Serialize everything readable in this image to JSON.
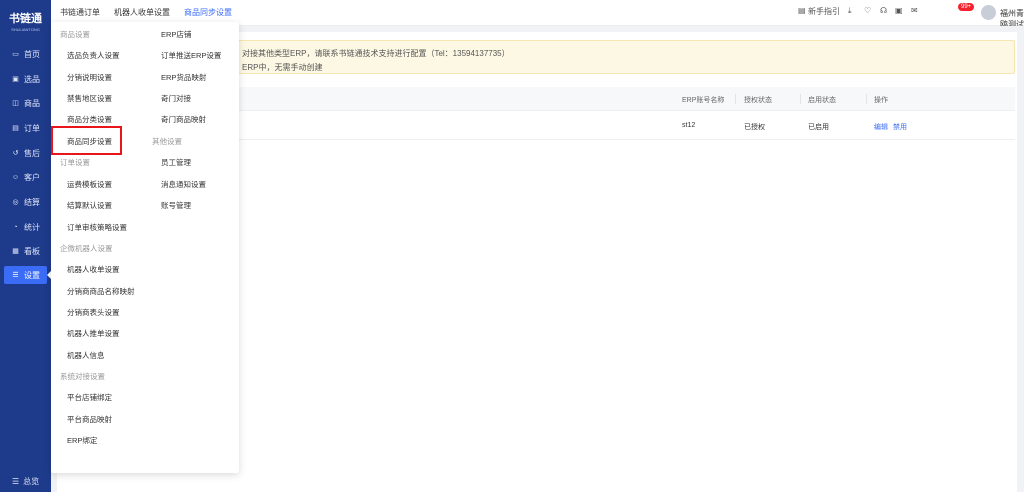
{
  "sidebar": {
    "logo_title": "书链通",
    "logo_sub": "SHULIANTONG",
    "items": [
      {
        "label": "首页",
        "icon": "monitor-icon"
      },
      {
        "label": "选品",
        "icon": "select-icon"
      },
      {
        "label": "商品",
        "icon": "goods-icon"
      },
      {
        "label": "订单",
        "icon": "order-icon"
      },
      {
        "label": "售后",
        "icon": "after-sale-icon"
      },
      {
        "label": "客户",
        "icon": "customer-icon"
      },
      {
        "label": "结算",
        "icon": "settlement-icon"
      },
      {
        "label": "统计",
        "icon": "stats-icon"
      },
      {
        "label": "看板",
        "icon": "board-icon"
      },
      {
        "label": "设置",
        "icon": "settings-icon"
      }
    ],
    "overview_label": "总览"
  },
  "topbar": {
    "tabs": [
      "书链通订单",
      "机器人收单设置",
      "商品同步设置"
    ],
    "guide_label": "新手指引",
    "badge": "99+",
    "username": "福州青鸥测试账号"
  },
  "alert": {
    "line1": "对接其他类型ERP，请联系书链通技术支持进行配置（Tel：13594137735）",
    "line2": "ERP中，无需手动创建"
  },
  "table": {
    "headers": [
      "ERP账号名称",
      "授权状态",
      "启用状态",
      "操作"
    ],
    "rows": [
      {
        "account": "st12",
        "auth": "已授权",
        "enabled": "已启用",
        "edit": "编辑",
        "disable": "禁用"
      }
    ]
  },
  "menu": {
    "col1": [
      {
        "type": "header",
        "label": "商品设置"
      },
      {
        "type": "item",
        "label": "选品负责人设置"
      },
      {
        "type": "item",
        "label": "分销说明设置"
      },
      {
        "type": "item",
        "label": "禁售地区设置"
      },
      {
        "type": "item",
        "label": "商品分类设置"
      },
      {
        "type": "item",
        "label": "商品同步设置"
      },
      {
        "type": "header",
        "label": "订单设置"
      },
      {
        "type": "item",
        "label": "运费模板设置"
      },
      {
        "type": "item",
        "label": "结算默认设置"
      },
      {
        "type": "item",
        "label": "订单审核策略设置"
      },
      {
        "type": "header",
        "label": "企微机器人设置"
      },
      {
        "type": "item",
        "label": "机器人收单设置"
      },
      {
        "type": "item",
        "label": "分销商商品名称映射"
      },
      {
        "type": "item",
        "label": "分销商表头设置"
      },
      {
        "type": "item",
        "label": "机器人推单设置"
      },
      {
        "type": "item",
        "label": "机器人信息"
      },
      {
        "type": "header",
        "label": "系统对接设置"
      },
      {
        "type": "item",
        "label": "平台店铺绑定"
      },
      {
        "type": "item",
        "label": "平台商品映射"
      },
      {
        "type": "item",
        "label": "ERP绑定"
      }
    ],
    "col2": [
      {
        "type": "item",
        "label": "ERP店铺"
      },
      {
        "type": "item",
        "label": "订单推送ERP设置"
      },
      {
        "type": "item",
        "label": "ERP货品映射"
      },
      {
        "type": "item",
        "label": "奇门对接"
      },
      {
        "type": "item",
        "label": "奇门商品映射"
      },
      {
        "type": "header",
        "label": "其他设置"
      },
      {
        "type": "item",
        "label": "员工管理"
      },
      {
        "type": "item",
        "label": "消息通知设置"
      },
      {
        "type": "item",
        "label": "账号管理"
      }
    ]
  }
}
